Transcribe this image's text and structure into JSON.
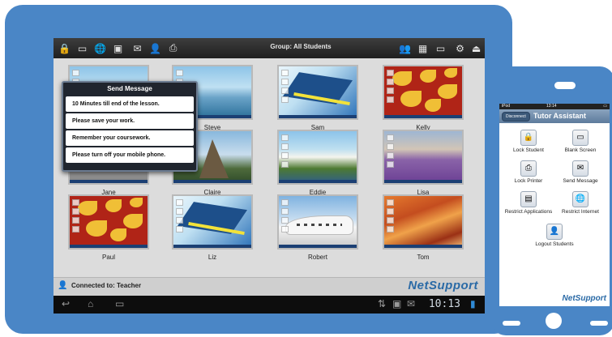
{
  "tablet": {
    "toolbar": {
      "group_title": "Group: All Students",
      "left_icons": [
        {
          "name": "lock-icon",
          "glyph": "🔒"
        },
        {
          "name": "blank-screen-icon",
          "glyph": "▭"
        },
        {
          "name": "globe-icon",
          "glyph": "🌐"
        },
        {
          "name": "monitor-icon",
          "glyph": "▣"
        },
        {
          "name": "message-icon",
          "glyph": "✉"
        },
        {
          "name": "user-logout-icon",
          "glyph": "👤"
        },
        {
          "name": "printer-icon",
          "glyph": "⎙"
        }
      ],
      "right_icons": [
        {
          "name": "users-icon",
          "glyph": "👥"
        },
        {
          "name": "grid-view-icon",
          "glyph": "▦"
        },
        {
          "name": "window-icon",
          "glyph": "▭"
        },
        {
          "name": "gear-icon",
          "glyph": "⚙"
        },
        {
          "name": "exit-icon",
          "glyph": "⏏"
        }
      ]
    },
    "popup": {
      "title": "Send Message",
      "messages": [
        "10 Minutes till end of the lesson.",
        "Please save your work.",
        "Remember your coursework.",
        "Please turn off your mobile phone."
      ]
    },
    "students": [
      {
        "name": "",
        "bg": "beach"
      },
      {
        "name": "Steve",
        "bg": "beach"
      },
      {
        "name": "Sam",
        "bg": "blue"
      },
      {
        "name": "Kelly",
        "bg": "leaves"
      },
      {
        "name": "Jane",
        "bg": "bench"
      },
      {
        "name": "Claire",
        "bg": "rock"
      },
      {
        "name": "Eddie",
        "bg": "cliffs"
      },
      {
        "name": "Lisa",
        "bg": "lavender"
      },
      {
        "name": "Paul",
        "bg": "leaves"
      },
      {
        "name": "Liz",
        "bg": "blue"
      },
      {
        "name": "Robert",
        "bg": "building"
      },
      {
        "name": "Tom",
        "bg": "canyon"
      }
    ],
    "status": {
      "connected": "Connected to: Teacher",
      "brand": "NetSupport"
    },
    "navbar": {
      "clock": "10:13"
    }
  },
  "phone": {
    "status_left": "iPod",
    "status_time": "13:14",
    "disconnect_label": "Disconnect",
    "title": "Tutor Assistant",
    "buttons": [
      {
        "label": "Lock Student",
        "icon": "lock-icon",
        "glyph": "🔒"
      },
      {
        "label": "Blank Screen",
        "icon": "blank-screen-icon",
        "glyph": "▭"
      },
      {
        "label": "Lock Printer",
        "icon": "printer-icon",
        "glyph": "⎙"
      },
      {
        "label": "Send Message",
        "icon": "message-icon",
        "glyph": "✉"
      },
      {
        "label": "Restrict Applications",
        "icon": "applications-icon",
        "glyph": "▤"
      },
      {
        "label": "Restrict Internet",
        "icon": "globe-icon",
        "glyph": "🌐"
      },
      {
        "label": "Logout Students",
        "icon": "user-logout-icon",
        "glyph": "👤"
      }
    ],
    "brand": "NetSupport"
  }
}
